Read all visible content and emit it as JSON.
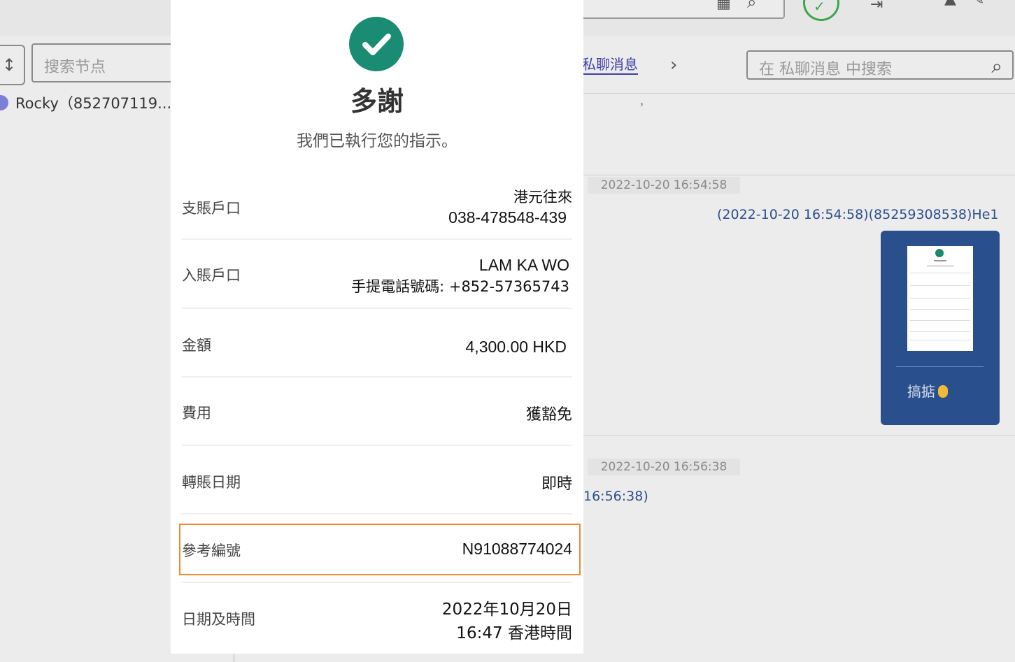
{
  "app": {
    "node_search_placeholder": "搜索节点",
    "contact_name": "Rocky（852707119...",
    "tab_private": "私聊消息",
    "message_search_placeholder": "在 私聊消息 中搜索",
    "comma_mark": "，"
  },
  "messages": [
    {
      "timestamp": "2022-10-20 16:54:58",
      "sender_line": "(2022-10-20 16:54:58)(85259308538)He1",
      "caption": "搞掂"
    },
    {
      "timestamp": "2022-10-20 16:56:38",
      "sender_line": "16:56:38)"
    }
  ],
  "receipt": {
    "title": "多謝",
    "subtitle": "我們已執行您的指示。",
    "rows": [
      {
        "label": "支賬戶口",
        "value_line1": "港元往來",
        "value_line2": "038-478548-439"
      },
      {
        "label": "入賬戶口",
        "value_line1": "LAM KA WO",
        "value_line2": "手提電話號碼: +852-57365743"
      },
      {
        "label": "金額",
        "value_line1": "4,300.00 HKD"
      },
      {
        "label": "費用",
        "value_line1": "獲豁免"
      },
      {
        "label": "轉賬日期",
        "value_line1": "即時"
      },
      {
        "label": "參考編號",
        "value_line1": "N91088774024"
      },
      {
        "label": "日期及時間",
        "value_line1": "2022年10月20日",
        "value_line2": "16:47 香港時間"
      }
    ]
  },
  "colors": {
    "brand_green": "#1a8c74",
    "highlight_orange": "#f08a2c",
    "bubble_blue": "#2a4f8d",
    "link_blue": "#2c4f8a"
  },
  "icons": [
    "calendar-icon",
    "search-icon",
    "check-circle-icon",
    "logout-icon",
    "user-icon",
    "pin-icon",
    "sort-icon",
    "chevron-right-icon",
    "ok-hand-emoji"
  ]
}
